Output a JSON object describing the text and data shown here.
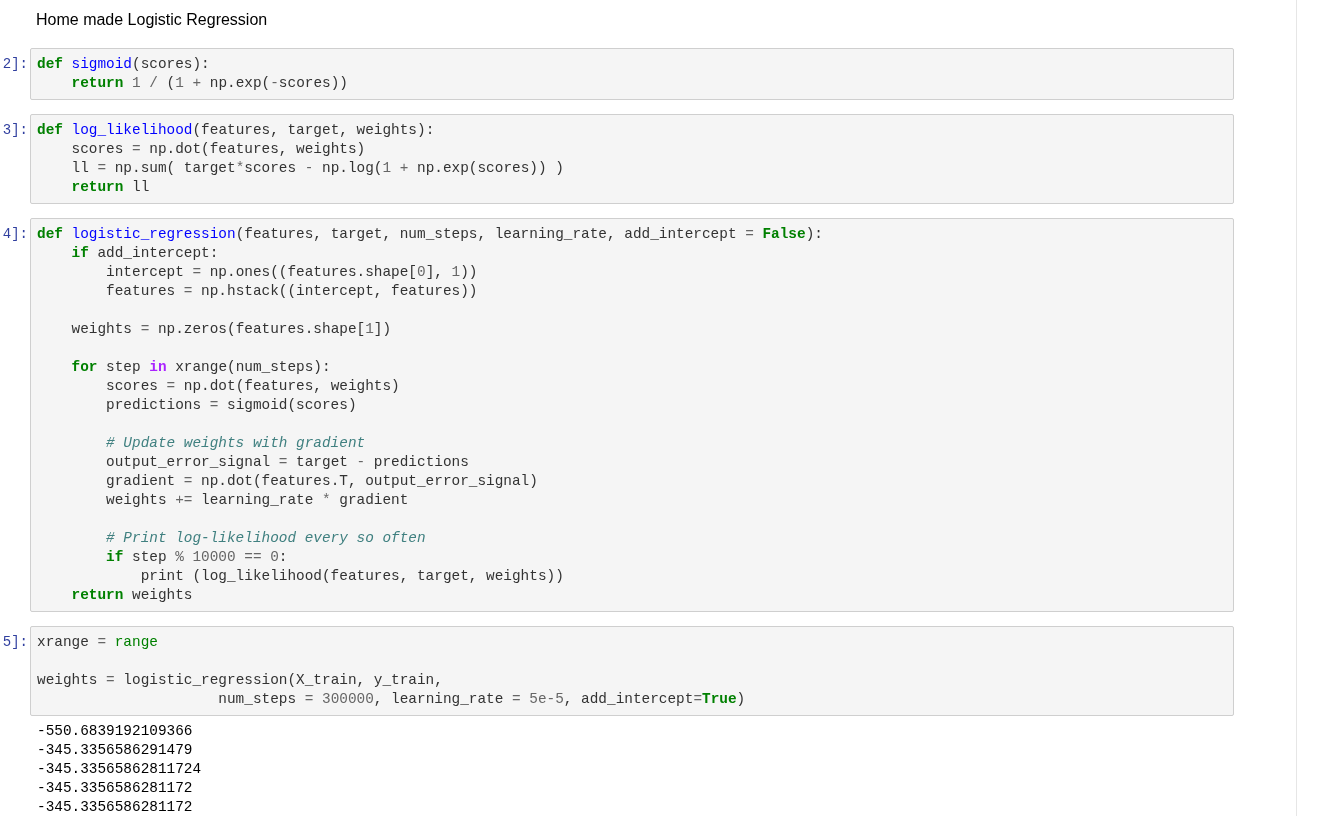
{
  "title": "Home made Logistic Regression",
  "cells": [
    {
      "prompt": "2]:",
      "blocks": [
        [
          [
            {
              "kind": "kw",
              "text": "def"
            },
            {
              "kind": "fn",
              "text": " sigmoid"
            },
            {
              "kind": "plain",
              "text": "(scores):"
            }
          ],
          [
            {
              "kind": "kw",
              "text": "    return"
            },
            {
              "kind": "num",
              "text": " 1"
            },
            {
              "kind": "op",
              "text": " /"
            },
            {
              "kind": "plain",
              "text": " ("
            },
            {
              "kind": "num",
              "text": "1"
            },
            {
              "kind": "op",
              "text": " +"
            },
            {
              "kind": "plain",
              "text": " np.exp("
            },
            {
              "kind": "op",
              "text": "-"
            },
            {
              "kind": "plain",
              "text": "scores))"
            }
          ]
        ]
      ]
    },
    {
      "prompt": "3]:",
      "blocks": [
        [
          [
            {
              "kind": "kw",
              "text": "def"
            },
            {
              "kind": "fn",
              "text": " log_likelihood"
            },
            {
              "kind": "plain",
              "text": "(features, target, weights):"
            }
          ],
          [
            {
              "kind": "plain",
              "text": "    scores "
            },
            {
              "kind": "op",
              "text": "="
            },
            {
              "kind": "plain",
              "text": " np.dot(features, weights)"
            }
          ],
          [
            {
              "kind": "plain",
              "text": "    ll "
            },
            {
              "kind": "op",
              "text": "="
            },
            {
              "kind": "plain",
              "text": " np.sum( target"
            },
            {
              "kind": "op",
              "text": "*"
            },
            {
              "kind": "plain",
              "text": "scores "
            },
            {
              "kind": "op",
              "text": "-"
            },
            {
              "kind": "plain",
              "text": " np.log("
            },
            {
              "kind": "num",
              "text": "1"
            },
            {
              "kind": "op",
              "text": " +"
            },
            {
              "kind": "plain",
              "text": " np.exp(scores)) )"
            }
          ],
          [
            {
              "kind": "kw",
              "text": "    return"
            },
            {
              "kind": "plain",
              "text": " ll"
            }
          ]
        ]
      ]
    },
    {
      "prompt": "4]:",
      "blocks": [
        [
          [
            {
              "kind": "kw",
              "text": "def"
            },
            {
              "kind": "fn",
              "text": " logistic_regression"
            },
            {
              "kind": "plain",
              "text": "(features, target, num_steps, learning_rate, add_intercept "
            },
            {
              "kind": "op",
              "text": "="
            },
            {
              "kind": "kw",
              "text": " False"
            },
            {
              "kind": "plain",
              "text": "):"
            }
          ],
          [
            {
              "kind": "kw",
              "text": "    if"
            },
            {
              "kind": "plain",
              "text": " add_intercept:"
            }
          ],
          [
            {
              "kind": "plain",
              "text": "        intercept "
            },
            {
              "kind": "op",
              "text": "="
            },
            {
              "kind": "plain",
              "text": " np.ones((features.shape["
            },
            {
              "kind": "num",
              "text": "0"
            },
            {
              "kind": "plain",
              "text": "], "
            },
            {
              "kind": "num",
              "text": "1"
            },
            {
              "kind": "plain",
              "text": "))"
            }
          ],
          [
            {
              "kind": "plain",
              "text": "        features "
            },
            {
              "kind": "op",
              "text": "="
            },
            {
              "kind": "plain",
              "text": " np.hstack((intercept, features))"
            }
          ]
        ],
        [
          [
            {
              "kind": "plain",
              "text": "    weights "
            },
            {
              "kind": "op",
              "text": "="
            },
            {
              "kind": "plain",
              "text": " np.zeros(features.shape["
            },
            {
              "kind": "num",
              "text": "1"
            },
            {
              "kind": "plain",
              "text": "])"
            }
          ]
        ],
        [
          [
            {
              "kind": "kw",
              "text": "    for"
            },
            {
              "kind": "plain",
              "text": " step "
            },
            {
              "kind": "opword",
              "text": "in"
            },
            {
              "kind": "plain",
              "text": " xrange(num_steps):"
            }
          ],
          [
            {
              "kind": "plain",
              "text": "        scores "
            },
            {
              "kind": "op",
              "text": "="
            },
            {
              "kind": "plain",
              "text": " np.dot(features, weights)"
            }
          ],
          [
            {
              "kind": "plain",
              "text": "        predictions "
            },
            {
              "kind": "op",
              "text": "="
            },
            {
              "kind": "plain",
              "text": " sigmoid(scores)"
            }
          ]
        ],
        [
          [
            {
              "kind": "cmt",
              "text": "        # Update weights with gradient"
            }
          ],
          [
            {
              "kind": "plain",
              "text": "        output_error_signal "
            },
            {
              "kind": "op",
              "text": "="
            },
            {
              "kind": "plain",
              "text": " target "
            },
            {
              "kind": "op",
              "text": "-"
            },
            {
              "kind": "plain",
              "text": " predictions"
            }
          ],
          [
            {
              "kind": "plain",
              "text": "        gradient "
            },
            {
              "kind": "op",
              "text": "="
            },
            {
              "kind": "plain",
              "text": " np.dot(features.T, output_error_signal)"
            }
          ],
          [
            {
              "kind": "plain",
              "text": "        weights "
            },
            {
              "kind": "op",
              "text": "+="
            },
            {
              "kind": "plain",
              "text": " learning_rate "
            },
            {
              "kind": "op",
              "text": "*"
            },
            {
              "kind": "plain",
              "text": " gradient"
            }
          ]
        ],
        [
          [
            {
              "kind": "cmt",
              "text": "        # Print log-likelihood every so often"
            }
          ],
          [
            {
              "kind": "kw",
              "text": "        if"
            },
            {
              "kind": "plain",
              "text": " step "
            },
            {
              "kind": "op",
              "text": "%"
            },
            {
              "kind": "num",
              "text": " 10000"
            },
            {
              "kind": "op",
              "text": " =="
            },
            {
              "kind": "num",
              "text": " 0"
            },
            {
              "kind": "plain",
              "text": ":"
            }
          ],
          [
            {
              "kind": "plain",
              "text": "            print (log_likelihood(features, target, weights))"
            }
          ],
          [
            {
              "kind": "kw",
              "text": "    return"
            },
            {
              "kind": "plain",
              "text": " weights"
            }
          ]
        ]
      ]
    },
    {
      "prompt": "5]:",
      "blocks": [
        [
          [
            {
              "kind": "plain",
              "text": "xrange "
            },
            {
              "kind": "op",
              "text": "="
            },
            {
              "kind": "builtin",
              "text": " range"
            }
          ]
        ],
        [
          [
            {
              "kind": "plain",
              "text": "weights "
            },
            {
              "kind": "op",
              "text": "="
            },
            {
              "kind": "plain",
              "text": " logistic_regression(X_train, y_train,"
            }
          ],
          [
            {
              "kind": "plain",
              "text": "                     num_steps "
            },
            {
              "kind": "op",
              "text": "="
            },
            {
              "kind": "num",
              "text": " 300000"
            },
            {
              "kind": "plain",
              "text": ", learning_rate "
            },
            {
              "kind": "op",
              "text": "="
            },
            {
              "kind": "num",
              "text": " 5e-5"
            },
            {
              "kind": "plain",
              "text": ", add_intercept"
            },
            {
              "kind": "op",
              "text": "="
            },
            {
              "kind": "kw",
              "text": "True"
            },
            {
              "kind": "plain",
              "text": ")"
            }
          ]
        ]
      ],
      "output": [
        "-550.6839192109366",
        "-345.3356586291479",
        "-345.33565862811724",
        "-345.3356586281172",
        "-345.3356586281172"
      ]
    }
  ]
}
